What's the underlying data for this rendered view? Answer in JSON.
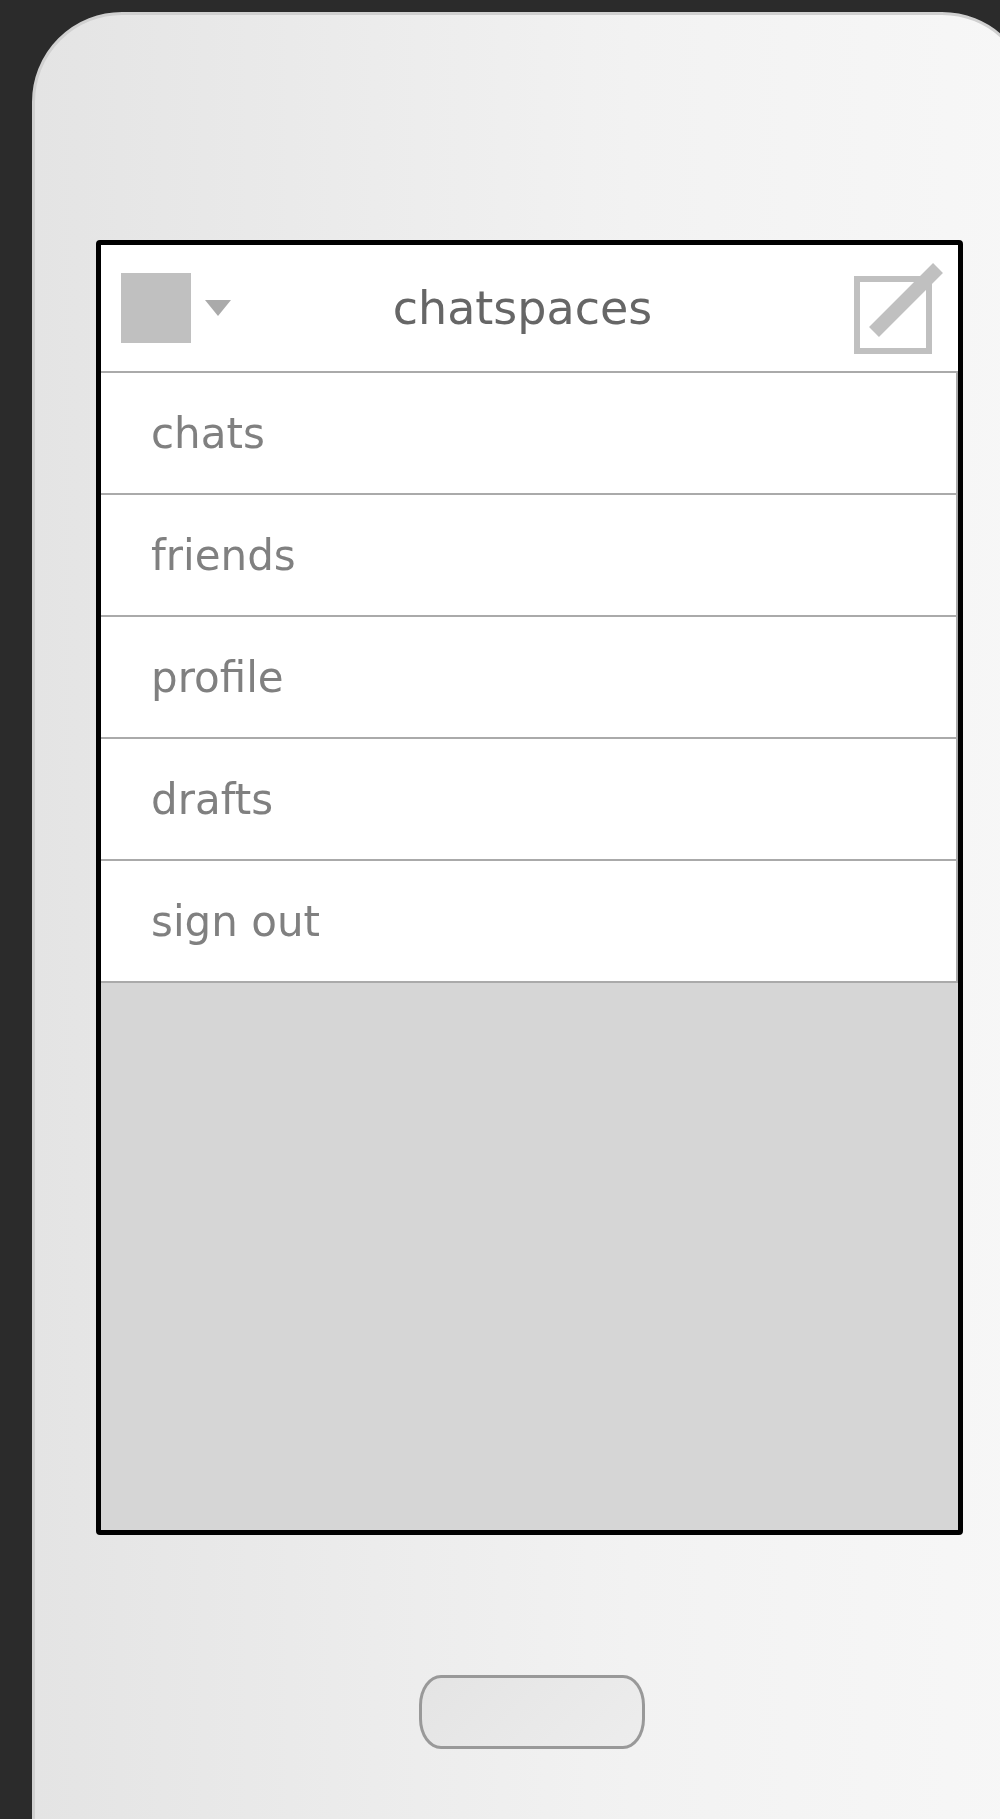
{
  "header": {
    "title": "chatspaces"
  },
  "menu": [
    {
      "label": "chats"
    },
    {
      "label": "friends"
    },
    {
      "label": "profile"
    },
    {
      "label": "drafts"
    },
    {
      "label": "sign out"
    }
  ]
}
